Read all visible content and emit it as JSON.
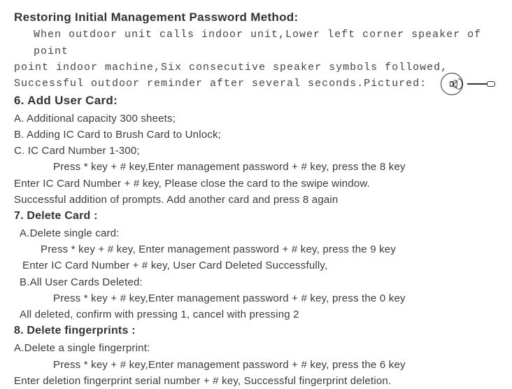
{
  "title": "Restoring Initial Management Password Method:",
  "intro": {
    "line1": "When outdoor unit calls indoor unit,Lower left corner speaker of point",
    "line2": "point indoor machine,Six consecutive speaker symbols followed,",
    "line3": "Successful outdoor reminder after several seconds.Pictured:"
  },
  "section6": {
    "head": "6. Add User Card:",
    "a": "A. Additional capacity 300 sheets;",
    "b": "B. Adding IC Card to Brush Card to Unlock;",
    "c": "C. IC Card Number 1-300;",
    "step1": "Press  *  key + # key,Enter management password + # key,  press the 8 key",
    "step2": "Enter IC Card Number + # key,  Please close the card to the swipe window.",
    "step3": "Successful addition of prompts. Add another card and press 8 again"
  },
  "section7": {
    "head": "7. Delete Card :",
    "a_head": "A.Delete single card:",
    "a_step1": "Press  *  key + # key, Enter management password  +  # key,  press the 9 key",
    "a_step2": "Enter IC Card Number + # key,  User Card Deleted Successfully,",
    "b_head": "B.All User Cards Deleted:",
    "b_step1": "Press  *  key + # key,Enter management password +  # key,  press the 0 key",
    "b_step2": "All deleted, confirm with pressing 1, cancel with pressing 2"
  },
  "section8": {
    "head": "8. Delete fingerprints :",
    "a_head": "A.Delete a single fingerprint:",
    "a_step1": "Press  *  key + # key,Enter management password +  # key,  press the 6 key",
    "a_step2": "Enter deletion fingerprint serial number + # key, Successful fingerprint deletion."
  },
  "icons": {
    "speaker": "speaker-icon",
    "slider": "slider-icon"
  }
}
